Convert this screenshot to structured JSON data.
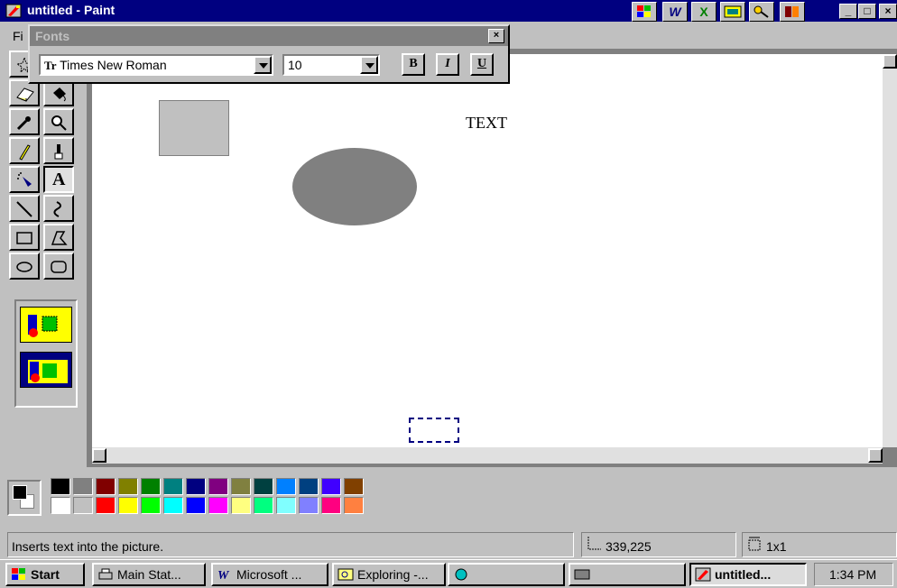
{
  "window": {
    "title": "untitled - Paint",
    "controls": {
      "minimize": "_",
      "maximize": "□",
      "close": "×"
    }
  },
  "titlebar_apps": [
    "W",
    "X"
  ],
  "menu": {
    "file_label": "Fi"
  },
  "fonts_toolbar": {
    "title": "Fonts",
    "close": "×",
    "font_name": "Times New Roman",
    "font_size": "10",
    "bold": "B",
    "italic": "I",
    "underline": "U"
  },
  "tools": [
    {
      "name": "free-form-select",
      "icon": "star-select-icon"
    },
    {
      "name": "select",
      "icon": "rect-select-icon"
    },
    {
      "name": "eraser",
      "icon": "eraser-icon"
    },
    {
      "name": "fill",
      "icon": "fill-bucket-icon"
    },
    {
      "name": "pick-color",
      "icon": "eyedropper-icon"
    },
    {
      "name": "magnifier",
      "icon": "magnifier-icon"
    },
    {
      "name": "pencil",
      "icon": "pencil-icon"
    },
    {
      "name": "brush",
      "icon": "brush-icon"
    },
    {
      "name": "airbrush",
      "icon": "airbrush-icon"
    },
    {
      "name": "text",
      "icon": "text-A-icon",
      "label": "A"
    },
    {
      "name": "line",
      "icon": "line-icon"
    },
    {
      "name": "curve",
      "icon": "curve-icon"
    },
    {
      "name": "rectangle",
      "icon": "rectangle-icon"
    },
    {
      "name": "polygon",
      "icon": "polygon-icon"
    },
    {
      "name": "ellipse",
      "icon": "ellipse-icon"
    },
    {
      "name": "rounded-rectangle",
      "icon": "rounded-rect-icon"
    }
  ],
  "canvas": {
    "text_object": "TEXT"
  },
  "palette": {
    "foreground": "#000000",
    "background": "#ffffff",
    "row1": [
      "#000000",
      "#808080",
      "#800000",
      "#808000",
      "#008000",
      "#008080",
      "#000080",
      "#800080",
      "#808040",
      "#004040",
      "#0080ff",
      "#004080",
      "#4000ff",
      "#804000"
    ],
    "row2": [
      "#ffffff",
      "#c0c0c0",
      "#ff0000",
      "#ffff00",
      "#00ff00",
      "#00ffff",
      "#0000ff",
      "#ff00ff",
      "#ffff80",
      "#00ff80",
      "#80ffff",
      "#8080ff",
      "#ff0080",
      "#ff8040"
    ]
  },
  "status": {
    "message": "Inserts text into the picture.",
    "coords": "339,225",
    "size": "1x1"
  },
  "taskbar": {
    "start": "Start",
    "items": [
      "Main Stat...",
      "Microsoft ...",
      "Exploring -...",
      "",
      "",
      "untitled..."
    ],
    "clock": "1:34 PM"
  }
}
